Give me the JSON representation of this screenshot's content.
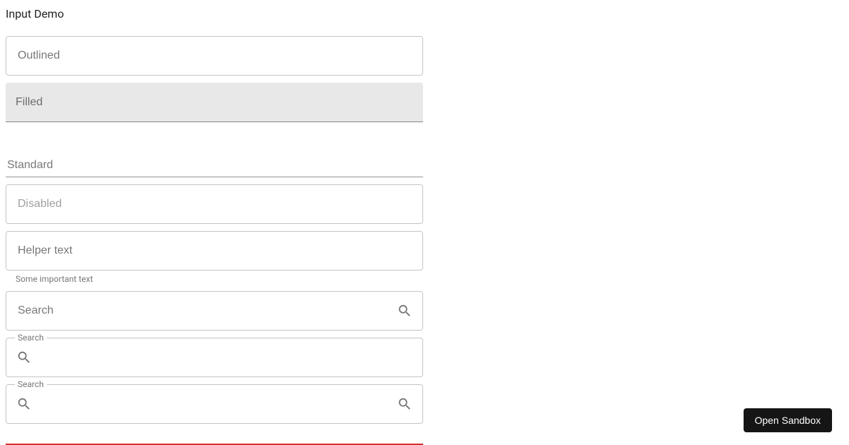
{
  "title": "Input Demo",
  "inputs": {
    "outlined": {
      "placeholder": "Outlined"
    },
    "filled": {
      "placeholder": "Filled"
    },
    "standard": {
      "placeholder": "Standard"
    },
    "disabled": {
      "placeholder": "Disabled"
    },
    "helper": {
      "placeholder": "Helper text",
      "helper_text": "Some important text"
    },
    "search_end": {
      "placeholder": "Search"
    },
    "search_start_labeled": {
      "label": "Search"
    },
    "search_both_labeled": {
      "label": "Search"
    }
  },
  "sandbox_button": {
    "label": "Open Sandbox"
  },
  "colors": {
    "error": "#d32f2f",
    "filled_bg": "#e8e8e8",
    "border": "rgba(0,0,0,0.23)"
  }
}
